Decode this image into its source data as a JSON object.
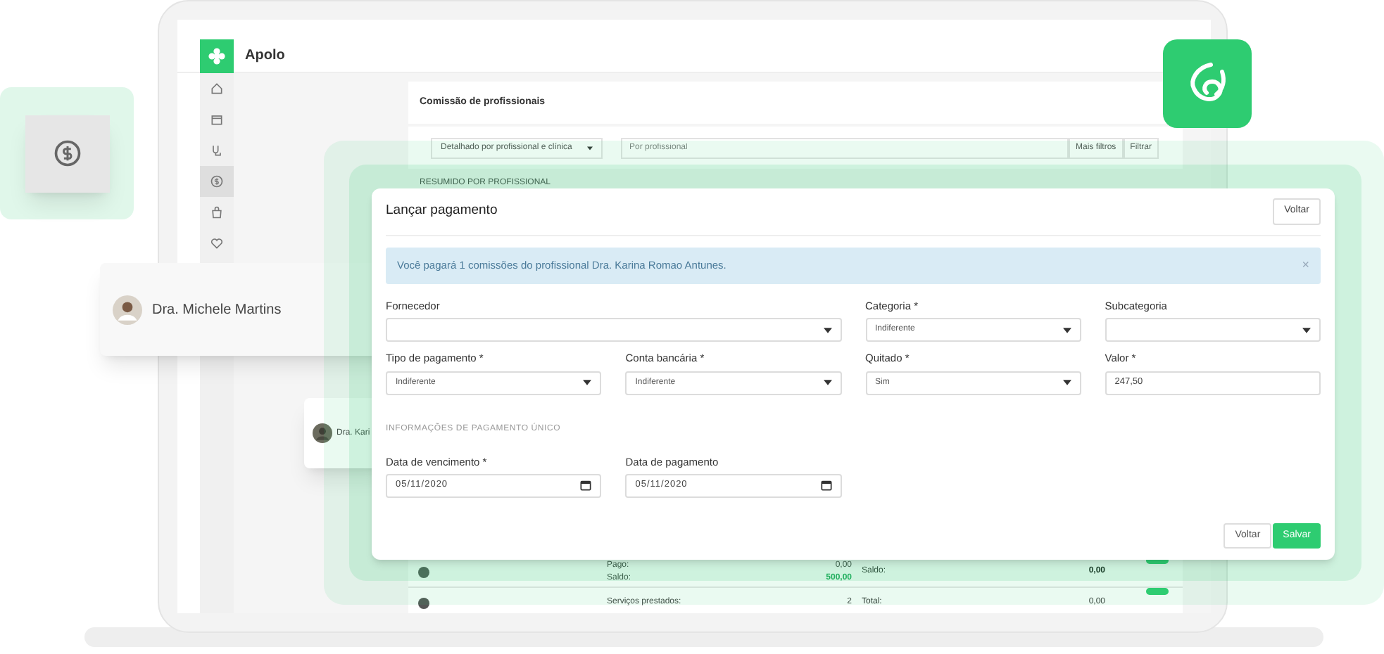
{
  "app": {
    "title": "Apolo",
    "sidebar": {
      "items": [
        {
          "selected": false
        },
        {
          "selected": false
        },
        {
          "selected": false
        },
        {
          "selected": true
        },
        {
          "selected": false
        },
        {
          "selected": false
        }
      ]
    },
    "page": {
      "title": "Comissão de profissionais",
      "report_select": "Detalhado por profissional e clínica",
      "search": {
        "placeholder": "Por profissional"
      },
      "buttons": [
        "Mais filtros",
        "Filtrar"
      ],
      "section": "RESUMIDO POR PROFISSIONAL",
      "summary_rows": [
        {
          "lines": [
            {
              "label": "Pago:",
              "value": "0,00",
              "highlight": false
            },
            {
              "label": "Saldo:",
              "value": "500,00",
              "highlight": true
            }
          ],
          "side_label": "Saldo:",
          "side_value": "0,00",
          "side_bold": true
        },
        {
          "lines": [
            {
              "label": "Serviços prestados:",
              "value": "2",
              "highlight": false
            }
          ],
          "side_label": "Total:",
          "side_value": "0,00",
          "side_bold": false
        }
      ]
    }
  },
  "modal": {
    "title": "Lançar pagamento",
    "header_button": "Voltar",
    "alert": {
      "text": "Você pagará 1 comissões do profissional Dra. Karina Romao Antunes.",
      "close": "×"
    },
    "fields": [
      {
        "label": "Fornecedor",
        "kind": "select",
        "wide": true
      },
      {
        "label": "Categoria *",
        "kind": "select",
        "value": "Indiferente",
        "wide": false
      },
      {
        "label": "Subcategoria",
        "kind": "select",
        "wide": false
      },
      {
        "label": "Tipo de pagamento *",
        "kind": "select",
        "value": "Indiferente",
        "wide": false
      },
      {
        "label": "Conta bancária *",
        "kind": "select",
        "value": "Indiferente",
        "wide": false
      },
      {
        "label": "Quitado *",
        "kind": "select",
        "value": "Sim",
        "wide": false
      },
      {
        "label": "Valor *",
        "kind": "input",
        "value": "247,50",
        "wide": false
      }
    ],
    "section": "INFORMAÇÕES DE PAGAMENTO ÚNICO",
    "date_fields": [
      {
        "label": "Data de vencimento *",
        "kind": "date",
        "value": "05/11/2020"
      },
      {
        "label": "Data de pagamento",
        "kind": "date",
        "value": "05/11/2020"
      }
    ],
    "footer_buttons": [
      {
        "label": "Voltar",
        "primary": false
      },
      {
        "label": "Salvar",
        "primary": true
      }
    ]
  },
  "floating_cards": [
    {
      "kind": "icon"
    },
    {
      "kind": "person",
      "name": "Dra. Michele Martins"
    },
    {
      "kind": "person",
      "name": "Dra. Kari"
    }
  ]
}
